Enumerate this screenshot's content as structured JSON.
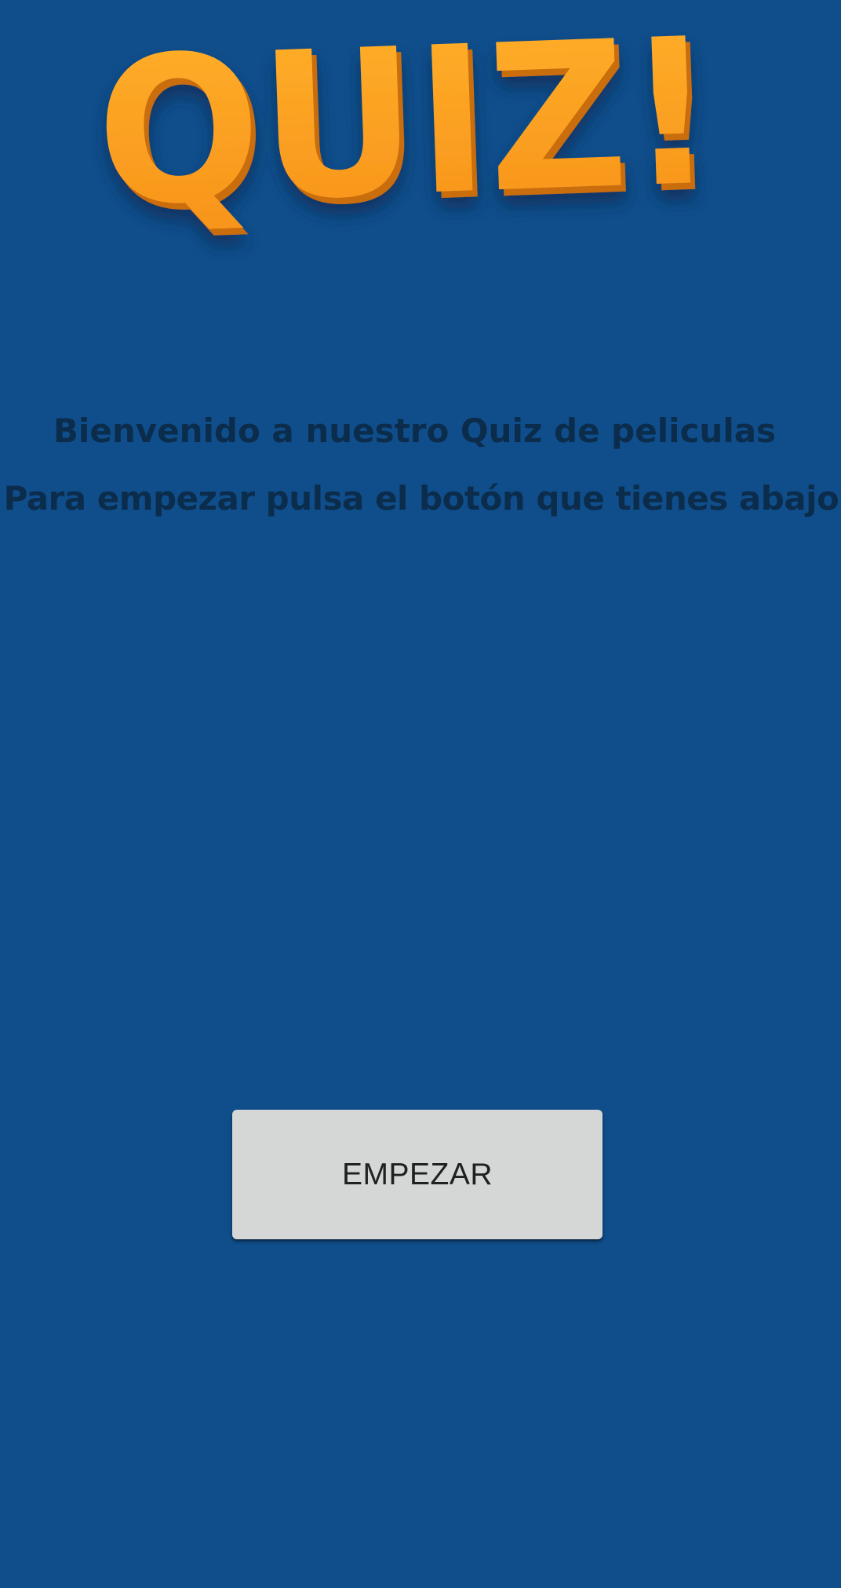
{
  "app": {
    "logo_text": "QUIZ!",
    "background_color": "#0f4e8b",
    "logo_color": "#ffa31f",
    "text_color": "#0c2c4c",
    "button_color": "#d5d7d6"
  },
  "welcome": {
    "line1": "Bienvenido a nuestro Quiz de peliculas",
    "line2": "Para empezar pulsa el botón que tienes abajo"
  },
  "actions": {
    "start_label": "EMPEZAR"
  }
}
